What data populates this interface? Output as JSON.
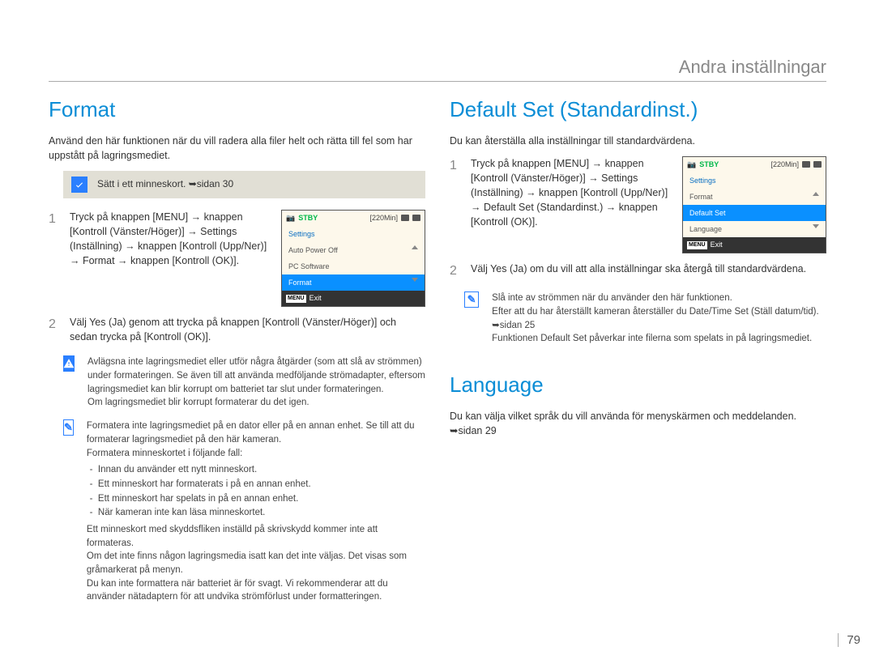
{
  "header": {
    "title": "Andra inställningar"
  },
  "page_number": "79",
  "left": {
    "heading": "Format",
    "intro": "Använd den här funktionen när du vill radera alla filer helt och rätta till fel som har uppstått på lagringsmediet.",
    "note": "Sätt i ett minneskort. ➥sidan 30",
    "steps": {
      "s1": "Tryck på knappen [MENU] → knappen [Kontroll (Vänster/Höger)] → Settings (Inställning) → knappen [Kontroll (Upp/Ner)] → Format → knappen [Kontroll (OK)].",
      "s2": "Välj Yes (Ja) genom att trycka på knappen [Kontroll (Vänster/Höger)] och sedan trycka på [Kontroll (OK)]."
    },
    "lcd": {
      "stby": "STBY",
      "time": "[220Min]",
      "settings": "Settings",
      "row1": "Auto Power Off",
      "row2": "PC Software",
      "selected": "Format",
      "exit": "Exit",
      "menu": "MENU"
    },
    "warn": {
      "p1": "Avlägsna inte lagringsmediet eller utför några åtgärder (som att slå av strömmen) under formateringen. Se även till att använda medföljande strömadapter, eftersom lagringsmediet kan blir korrupt om batteriet tar slut under formateringen.",
      "p2": "Om lagringsmediet blir korrupt formaterar du det igen."
    },
    "info": {
      "p1": "Formatera inte lagringsmediet på en dator eller på en annan enhet. Se till att du formaterar lagringsmediet på den här kameran.",
      "p2": "Formatera minneskortet i följande fall:",
      "b1": "Innan du använder ett nytt minneskort.",
      "b2": "Ett minneskort har formaterats i på en annan enhet.",
      "b3": "Ett minneskort har spelats in på en annan enhet.",
      "b4": "När kameran inte kan läsa minneskortet.",
      "p3": "Ett minneskort med skyddsfliken inställd på skrivskydd kommer inte att formateras.",
      "p4": "Om det inte finns någon lagringsmedia isatt kan det inte väljas. Det visas som gråmarkerat på menyn.",
      "p5": "Du kan inte formattera när batteriet är för svagt. Vi rekommenderar att du använder nätadaptern för att undvika strömförlust under formatteringen."
    }
  },
  "right": {
    "heading1": "Default Set (Standardinst.)",
    "intro1": "Du kan återställa alla inställningar till standardvärdena.",
    "steps": {
      "s1": "Tryck på knappen [MENU] → knappen [Kontroll (Vänster/Höger)] → Settings (Inställning) → knappen [Kontroll (Upp/Ner)] → Default Set (Standardinst.) → knappen [Kontroll (OK)].",
      "s2": "Välj Yes (Ja) om du vill att alla inställningar ska återgå till standardvärdena."
    },
    "lcd": {
      "stby": "STBY",
      "time": "[220Min]",
      "settings": "Settings",
      "row1": "Format",
      "selected": "Default Set",
      "row3": "Language",
      "exit": "Exit",
      "menu": "MENU"
    },
    "info": {
      "p1": "Slå inte av strömmen när du använder den här funktionen.",
      "p2": "Efter att du har återställt kameran återställer du Date/Time Set (Ställ datum/tid). ➥sidan 25",
      "p3": "Funktionen Default Set påverkar inte filerna som spelats in på lagringsmediet."
    },
    "heading2": "Language",
    "intro2": "Du kan välja vilket språk du vill använda för menyskärmen och meddelanden. ➥sidan 29"
  }
}
